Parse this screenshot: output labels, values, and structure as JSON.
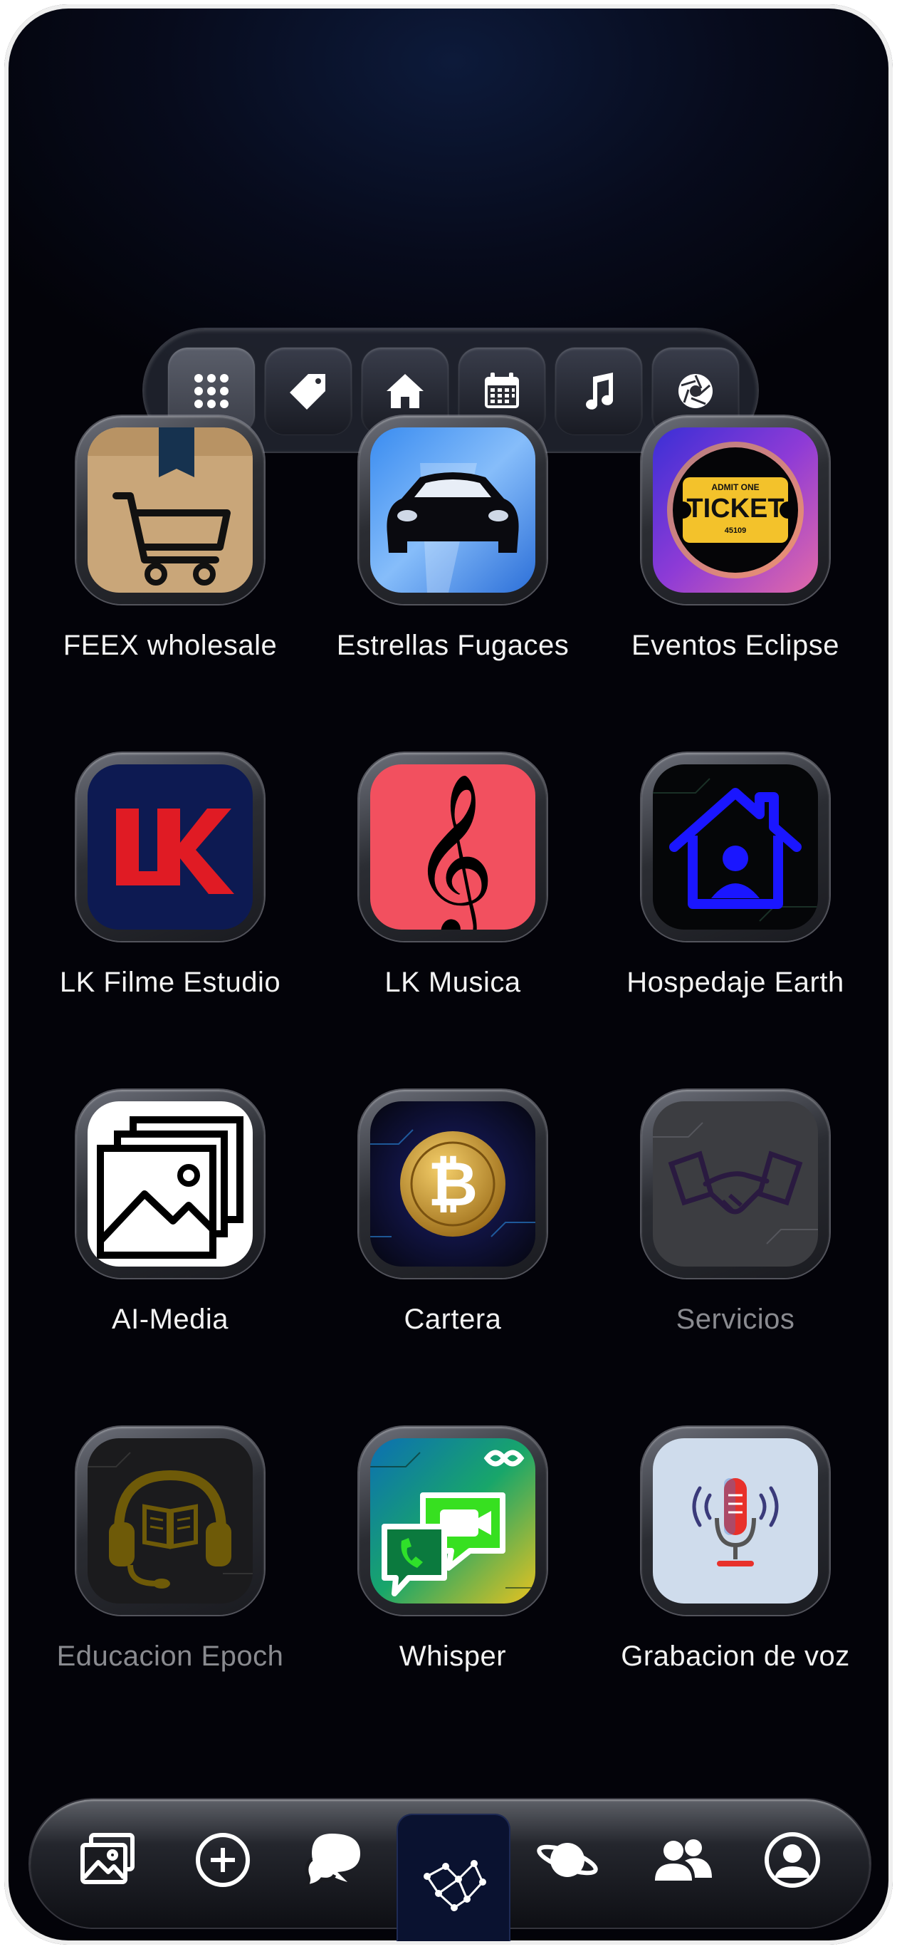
{
  "categories": [
    {
      "name": "apps-grid-icon",
      "active": true
    },
    {
      "name": "tag-icon",
      "active": false
    },
    {
      "name": "home-icon",
      "active": false
    },
    {
      "name": "calendar-icon",
      "active": false
    },
    {
      "name": "music-note-icon",
      "active": false
    },
    {
      "name": "aperture-icon",
      "active": false
    }
  ],
  "apps": [
    {
      "label": "FEEX wholesale",
      "icon": "shopping-cart-icon",
      "dimmed": false
    },
    {
      "label": "Estrellas Fugaces",
      "icon": "car-icon",
      "dimmed": false
    },
    {
      "label": "Eventos Eclipse",
      "icon": "ticket-icon",
      "dimmed": false
    },
    {
      "label": "LK Filme Estudio",
      "icon": "lk-logo-icon",
      "dimmed": false
    },
    {
      "label": "LK Musica",
      "icon": "treble-clef-icon",
      "dimmed": false
    },
    {
      "label": "Hospedaje Earth",
      "icon": "house-user-icon",
      "dimmed": false
    },
    {
      "label": "AI-Media",
      "icon": "image-gallery-icon",
      "dimmed": false
    },
    {
      "label": "Cartera",
      "icon": "bitcoin-icon",
      "dimmed": false
    },
    {
      "label": "Servicios",
      "icon": "handshake-icon",
      "dimmed": true
    },
    {
      "label": "Educacion Epoch",
      "icon": "headphones-book-icon",
      "dimmed": true
    },
    {
      "label": "Whisper",
      "icon": "video-chat-icon",
      "dimmed": false
    },
    {
      "label": "Grabacion de voz",
      "icon": "microphone-icon",
      "dimmed": false
    }
  ],
  "ticket": {
    "top": "ADMIT ONE",
    "main": "TICKET",
    "number": "45109"
  },
  "lk_logo": "LK",
  "bottom_nav": [
    {
      "name": "gallery-icon"
    },
    {
      "name": "add-circle-icon"
    },
    {
      "name": "chat-bubbles-icon"
    },
    {
      "name": "network-icon",
      "active": true
    },
    {
      "name": "planet-icon"
    },
    {
      "name": "people-icon"
    },
    {
      "name": "profile-icon"
    }
  ],
  "colors": {
    "background": "#05060d",
    "accent_active_nav": "#0a1230"
  }
}
